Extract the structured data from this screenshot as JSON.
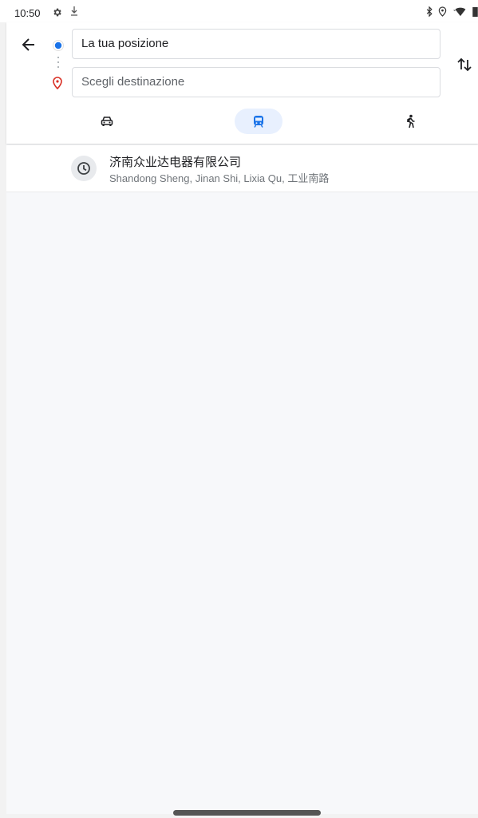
{
  "status_bar": {
    "time": "10:50",
    "icons": [
      "settings-icon",
      "download-icon",
      "bluetooth-icon",
      "location-icon",
      "wifi-icon",
      "battery-icon"
    ]
  },
  "directions": {
    "origin_value": "La tua posizione",
    "destination_placeholder": "Scegli destinazione",
    "modes": [
      {
        "name": "car",
        "icon": "car-icon",
        "selected": false
      },
      {
        "name": "transit",
        "icon": "train-icon",
        "selected": true
      },
      {
        "name": "walk",
        "icon": "walk-icon",
        "selected": false
      }
    ]
  },
  "results": [
    {
      "icon": "history-clock-icon",
      "title": "济南众业达电器有限公司",
      "subtitle": "Shandong Sheng, Jinan Shi, Lixia Qu, 工业南路"
    }
  ],
  "colors": {
    "accent": "#1a73e8",
    "destination_pin": "#d93025",
    "selected_mode_bg": "#e8f0fe"
  }
}
